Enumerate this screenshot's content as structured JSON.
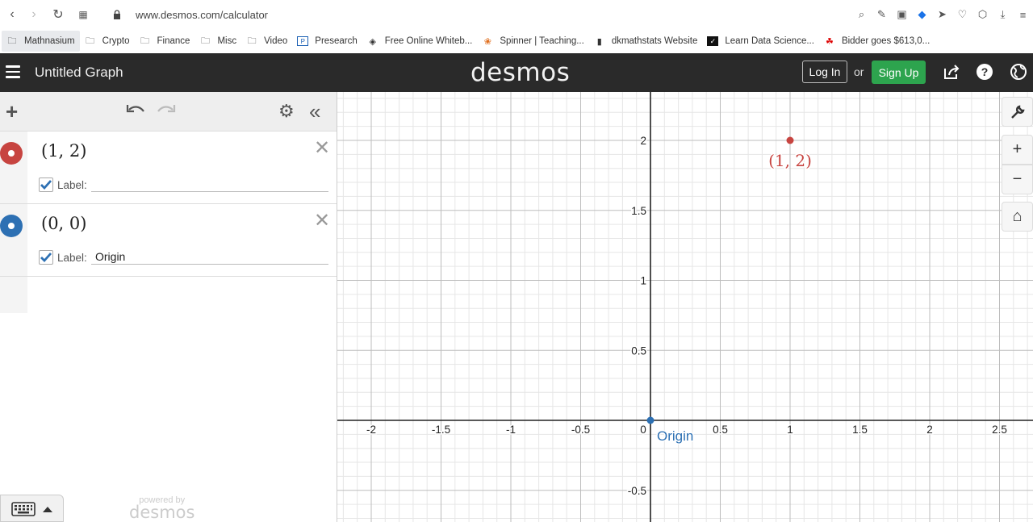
{
  "browser": {
    "url": "www.desmos.com/calculator",
    "bookmarks": [
      "Mathnasium",
      "Crypto",
      "Finance",
      "Misc",
      "Video",
      "Presearch",
      "Free Online Whiteb...",
      "Spinner | Teaching...",
      "dkmathstats Website",
      "Learn Data Science...",
      "Bidder goes $613,0..."
    ]
  },
  "header": {
    "title": "Untitled Graph",
    "logo": "desmos",
    "login": "Log In",
    "or": "or",
    "signup": "Sign Up"
  },
  "expressions": [
    {
      "math": "(1, 2)",
      "color": "#c74440",
      "label_prompt": "Label:",
      "label_value": ""
    },
    {
      "math": "(0, 0)",
      "color": "#2d70b3",
      "label_prompt": "Label:",
      "label_value": "Origin"
    }
  ],
  "footer": {
    "powered_by": "powered by",
    "brand": "desmos"
  },
  "graph": {
    "x_ticks": [
      "-2",
      "-1.5",
      "-1",
      "-0.5",
      "0",
      "0.5",
      "1",
      "1.5",
      "2",
      "2.5"
    ],
    "y_ticks": [
      "2",
      "1.5",
      "1",
      "0.5",
      "-0.5"
    ],
    "points": [
      {
        "x": 1,
        "y": 2,
        "label": "(1, 2)",
        "color": "#c74440"
      },
      {
        "x": 0,
        "y": 0,
        "label": "Origin",
        "color": "#2d70b3"
      }
    ]
  }
}
